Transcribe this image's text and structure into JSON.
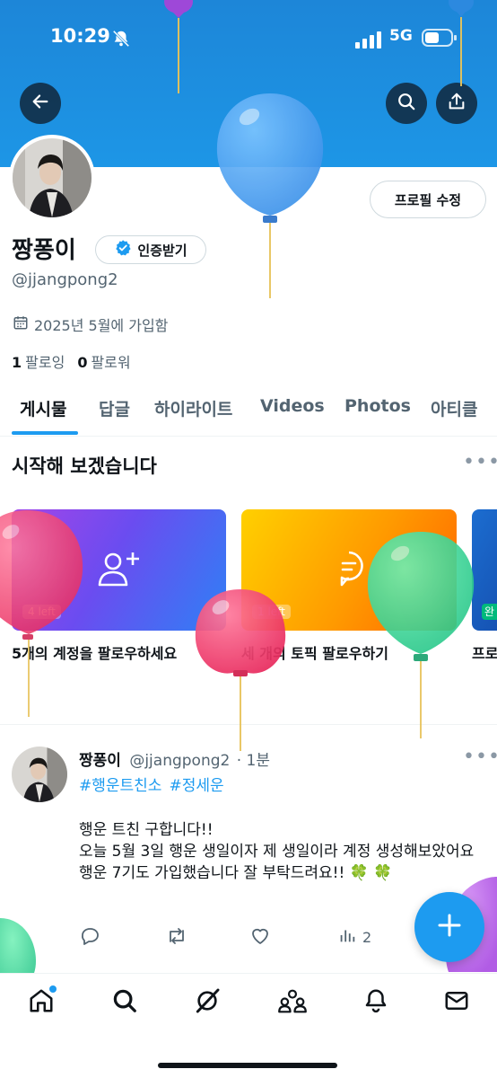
{
  "status": {
    "time": "10:29",
    "network": "5G"
  },
  "profile": {
    "name": "짱퐁이",
    "verify_label": "인증받기",
    "handle": "@jjangpong2",
    "joined": "2025년 5월에 가입함",
    "following_count": "1",
    "following_label": "팔로잉",
    "followers_count": "0",
    "followers_label": "팔로워",
    "edit_label": "프로필 수정"
  },
  "tabs": [
    "게시물",
    "답글",
    "하이라이트",
    "Videos",
    "Photos",
    "아티클"
  ],
  "onboarding": {
    "title": "시작해 보겠습니다",
    "cards": [
      {
        "label": "5개의 계정을 팔로우하세요",
        "badge": "4 left"
      },
      {
        "label": "세 개의 토픽 팔로우하기",
        "badge": "1 left"
      },
      {
        "label": "프로",
        "badge": "완"
      }
    ]
  },
  "tweet": {
    "name": "짱퐁이",
    "handle": "@jjangpong2",
    "time": "· 1분",
    "hashtags": [
      "#행운트친소",
      "#정세운"
    ],
    "lines": [
      "행운 트친 구합니다!!",
      "오늘 5월 3일 행운 생일이자 제 생일이라 계정 생성해보았어요",
      "행운 7기도 가입했습니다 잘 부탁드려요!! 🍀 🍀"
    ],
    "views": "2"
  },
  "icons": {
    "back": "arrow-left-icon",
    "search": "search-icon",
    "share": "share-icon",
    "fab": "plus-icon",
    "nav": [
      "home-icon",
      "search-icon",
      "grok-icon",
      "communities-icon",
      "bell-icon",
      "mail-icon"
    ]
  },
  "colors": {
    "accent": "#1d9bf0",
    "banner": "#1d8fe0"
  }
}
